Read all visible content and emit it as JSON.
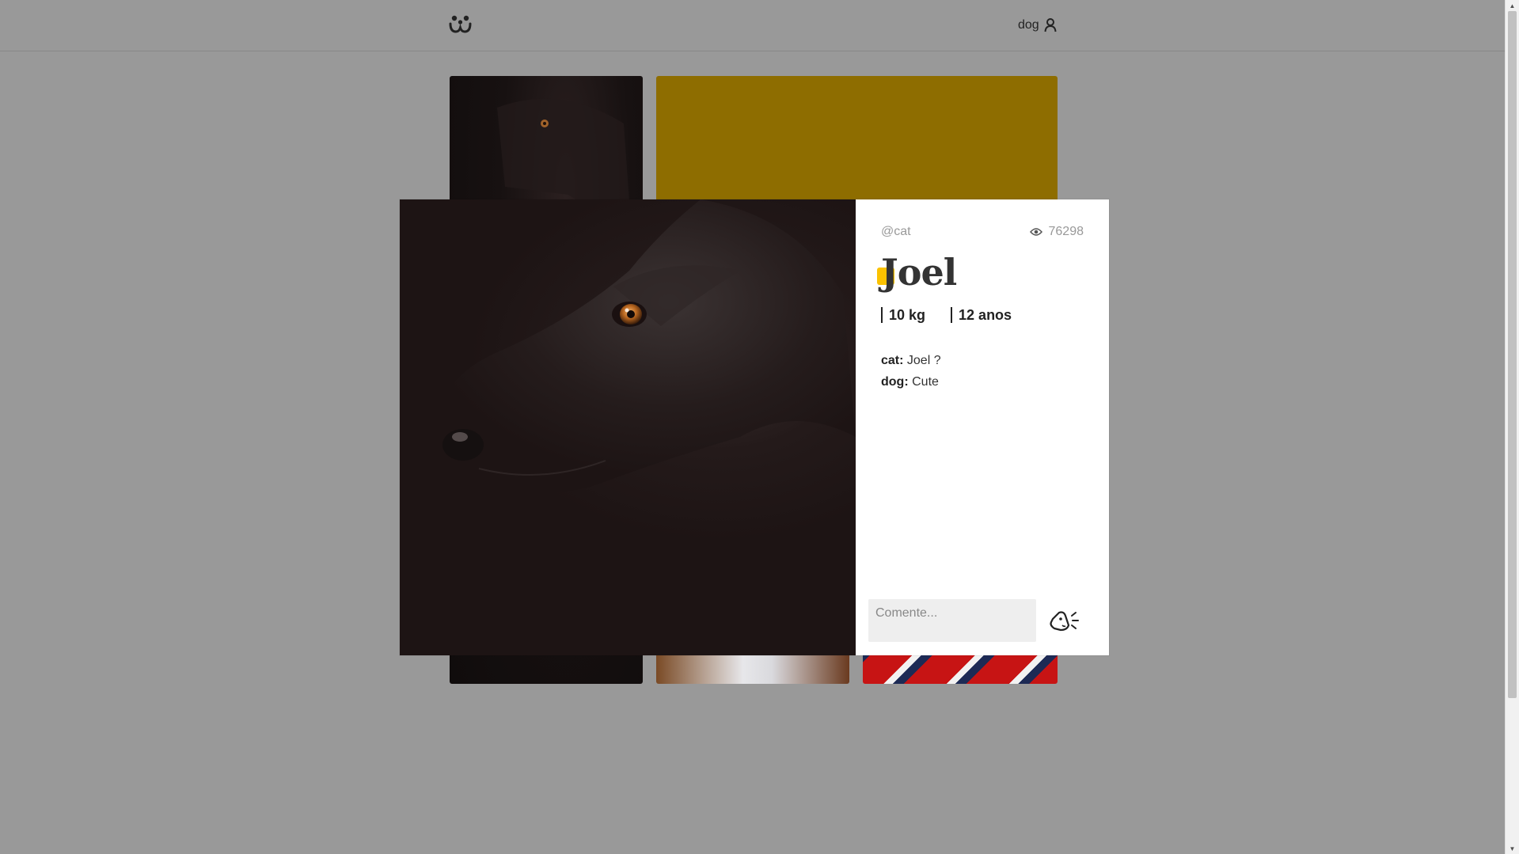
{
  "header": {
    "user_label": "dog"
  },
  "photo_modal": {
    "author": "@cat",
    "views": "76298",
    "name": "Joel",
    "weight": "10 kg",
    "age": "12 anos",
    "comments": [
      {
        "author": "cat:",
        "text": "Joel ?"
      },
      {
        "author": "dog:",
        "text": "Cute"
      }
    ],
    "comment_placeholder": "Comente..."
  },
  "colors": {
    "accent": "#fbc200",
    "overlay": "#999999",
    "input_bg": "#eeeeee"
  },
  "icons": [
    "dogs-logo-icon",
    "user-icon",
    "eye-icon",
    "send-bark-icon"
  ]
}
